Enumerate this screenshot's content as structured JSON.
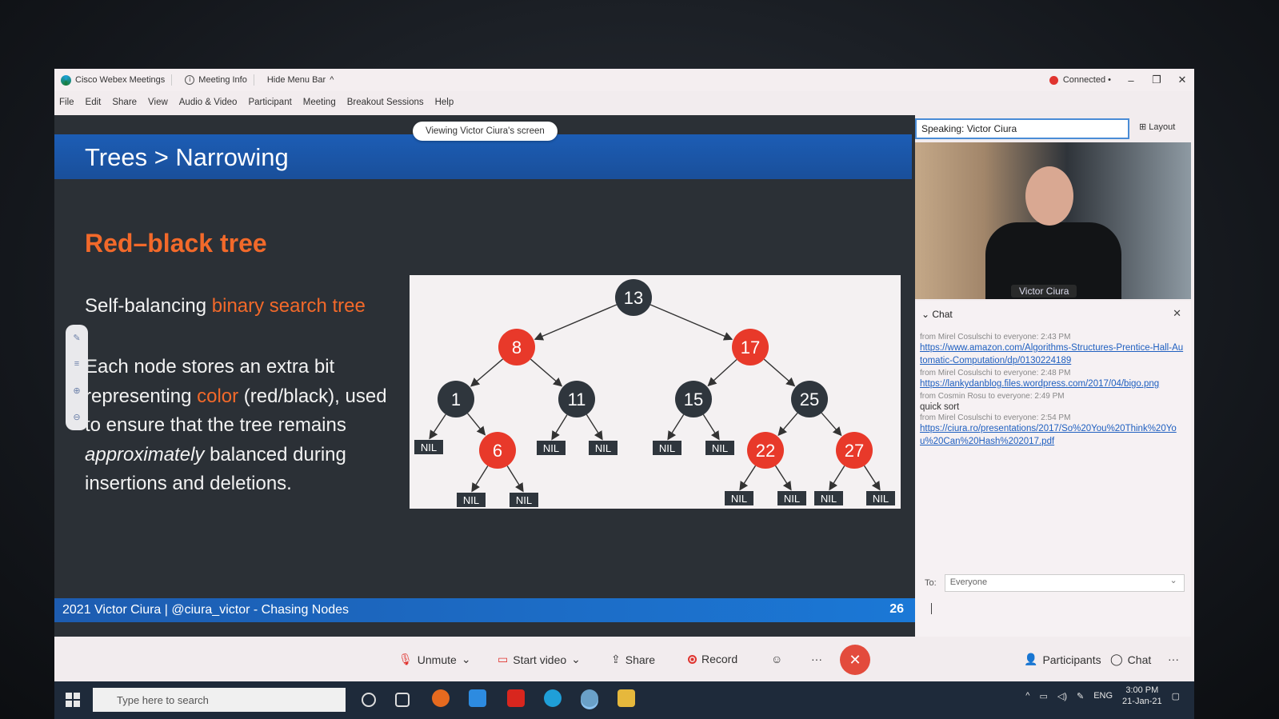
{
  "window": {
    "app_title": "Cisco Webex Meetings",
    "meeting_info": "Meeting Info",
    "hide_menu": "Hide Menu Bar",
    "status": "Connected"
  },
  "menu": [
    "File",
    "Edit",
    "Share",
    "View",
    "Audio & Video",
    "Participant",
    "Meeting",
    "Breakout Sessions",
    "Help"
  ],
  "share": {
    "viewing_label": "Viewing Victor Ciura's screen"
  },
  "slide": {
    "title": "Trees > Narrowing",
    "heading": "Red–black tree",
    "sub_prefix": "Self-balancing ",
    "sub_highlight": "binary search tree",
    "body_1": "Each node stores an extra bit representing ",
    "body_color": "color",
    "body_2": " (red/black), used to ensure that the tree remains ",
    "body_em": "approximately",
    "body_3": " balanced during insertions and deletions.",
    "footer": "2021  Victor Ciura  |  @ciura_victor  -  Chasing Nodes",
    "page": "26"
  },
  "tree": {
    "nodes": [
      {
        "label": "13",
        "color": "black"
      },
      {
        "label": "8",
        "color": "red"
      },
      {
        "label": "17",
        "color": "red"
      },
      {
        "label": "1",
        "color": "black"
      },
      {
        "label": "11",
        "color": "black"
      },
      {
        "label": "15",
        "color": "black"
      },
      {
        "label": "25",
        "color": "black"
      },
      {
        "label": "6",
        "color": "red"
      },
      {
        "label": "22",
        "color": "red"
      },
      {
        "label": "27",
        "color": "red"
      }
    ],
    "nil_label": "NIL",
    "colors": {
      "red": "#e8392a",
      "black": "#2f363d",
      "nil": "#2f363d"
    }
  },
  "video": {
    "speaking": "Speaking: Victor Ciura",
    "layout": "Layout",
    "name": "Victor Ciura"
  },
  "chat": {
    "title": "Chat",
    "messages": [
      {
        "meta": "from Mirel Cosulschi to everyone:   2:43 PM",
        "text": "https://www.amazon.com/Algorithms-Structures-Prentice-Hall-Automatic-Computation/dp/0130224189",
        "link": true
      },
      {
        "meta": "from Mirel Cosulschi to everyone:   2:48 PM",
        "text": "https://lankydanblog.files.wordpress.com/2017/04/bigo.png",
        "link": true
      },
      {
        "meta": "from Cosmin Rosu to everyone:   2:49 PM",
        "text": "quick sort",
        "link": false
      },
      {
        "meta": "from Mirel Cosulschi to everyone:   2:54 PM",
        "text": "https://ciura.ro/presentations/2017/So%20You%20Think%20You%20Can%20Hash%202017.pdf",
        "link": true
      }
    ],
    "to_label": "To:",
    "to_value": "Everyone"
  },
  "controls": {
    "unmute": "Unmute",
    "start_video": "Start video",
    "share": "Share",
    "record": "Record",
    "more": "···",
    "participants": "Participants",
    "chat": "Chat"
  },
  "taskbar": {
    "search_placeholder": "Type here to search",
    "lang": "ENG",
    "time": "3:00 PM",
    "date": "21-Jan-21"
  }
}
